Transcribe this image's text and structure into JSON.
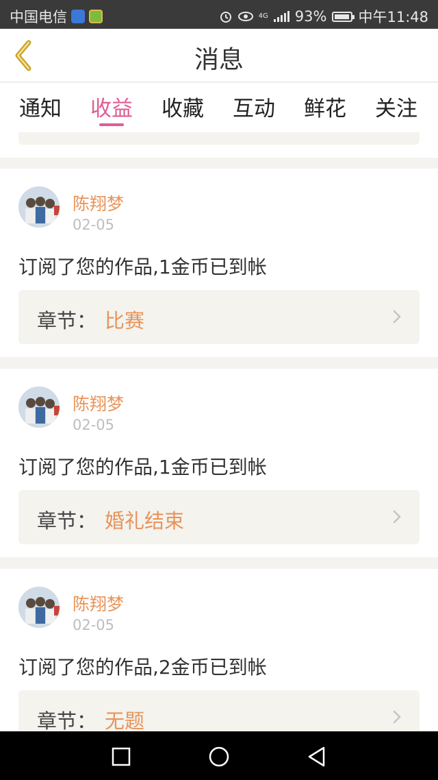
{
  "status_bar": {
    "carrier": "中国电信",
    "network": "4G",
    "battery": "93%",
    "battery_level": 0.93,
    "time": "中午11:48"
  },
  "header": {
    "title": "消息",
    "back_icon": "chevron-left-icon"
  },
  "tabs": [
    {
      "label": "通知",
      "active": false
    },
    {
      "label": "收益",
      "active": true
    },
    {
      "label": "收藏",
      "active": false
    },
    {
      "label": "互动",
      "active": false
    },
    {
      "label": "鲜花",
      "active": false
    },
    {
      "label": "关注",
      "active": false
    }
  ],
  "messages": [
    {
      "user": "陈翔梦",
      "date": "02-05",
      "text": "订阅了您的作品,1金币已到帐",
      "chapter_label": "章节：",
      "chapter": "比赛"
    },
    {
      "user": "陈翔梦",
      "date": "02-05",
      "text": "订阅了您的作品,1金币已到帐",
      "chapter_label": "章节：",
      "chapter": "婚礼结束"
    },
    {
      "user": "陈翔梦",
      "date": "02-05",
      "text": "订阅了您的作品,2金币已到帐",
      "chapter_label": "章节：",
      "chapter": "无题"
    }
  ],
  "colors": {
    "accent": "#e05b94",
    "name_orange": "#e8935a",
    "back_icon_gold": "#c9a227"
  },
  "nav_icons": [
    "square-icon",
    "circle-icon",
    "triangle-back-icon"
  ]
}
